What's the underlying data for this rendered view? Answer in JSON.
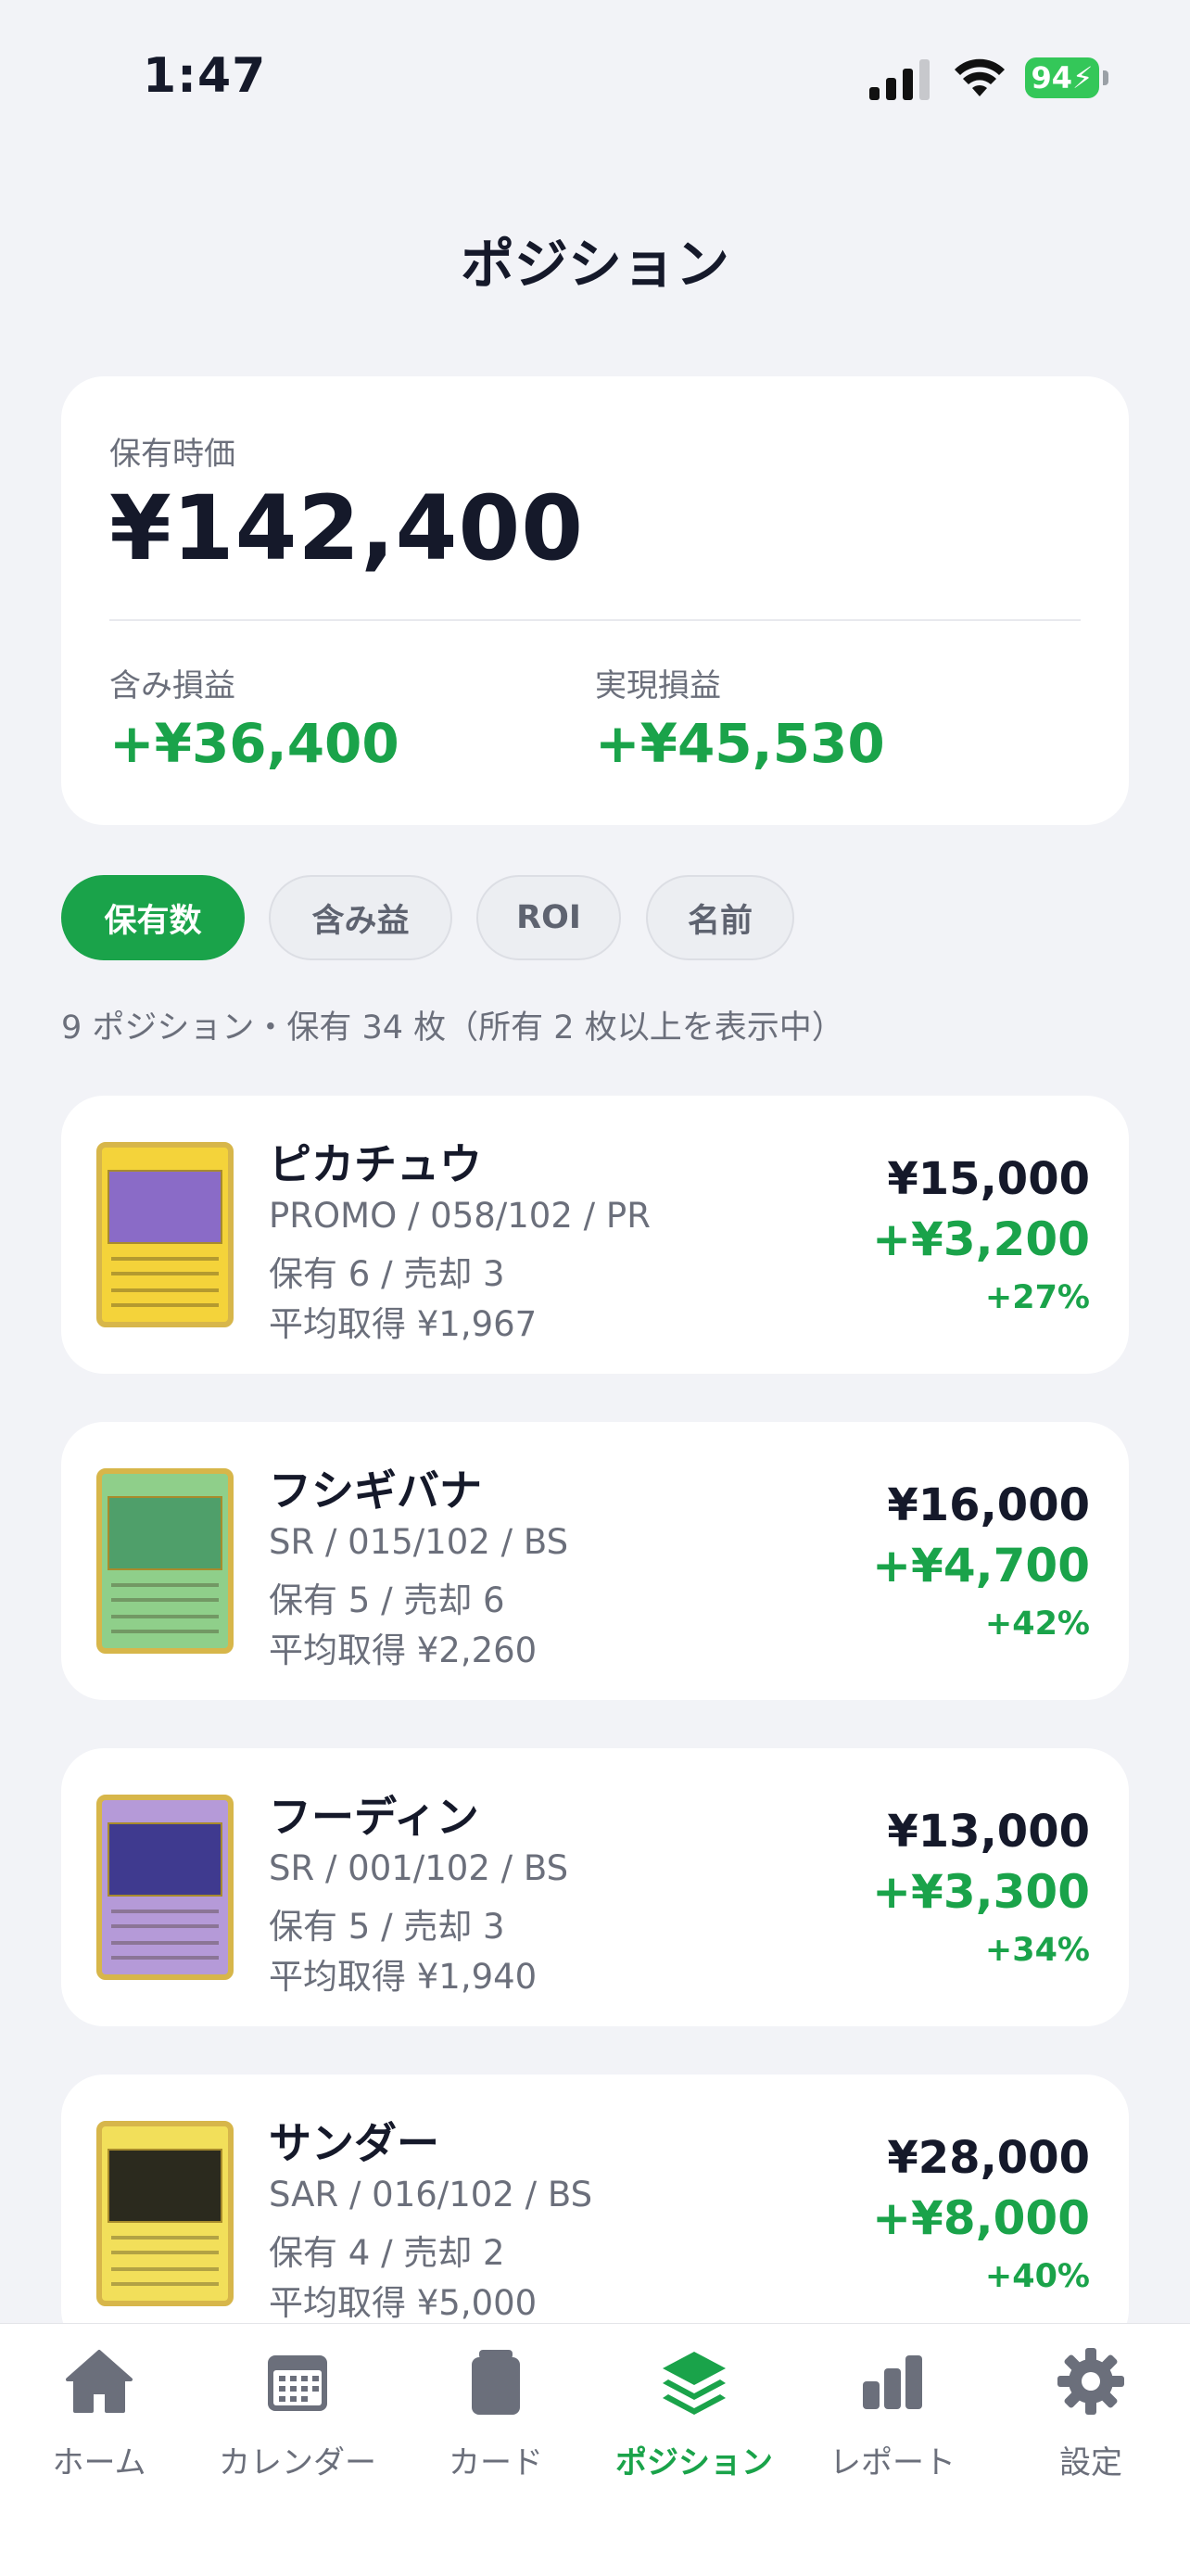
{
  "status_bar": {
    "time": "1:47",
    "battery": "94"
  },
  "title": "ポジション",
  "summary": {
    "holding_value_label": "保有時価",
    "holding_value": "¥142,400",
    "unrealized_label": "含み損益",
    "unrealized_value": "+¥36,400",
    "realized_label": "実現損益",
    "realized_value": "+¥45,530"
  },
  "sort_chips": [
    "保有数",
    "含み益",
    "ROI",
    "名前"
  ],
  "active_chip": "保有数",
  "caption": "9 ポジション・保有 34 枚（所有 2 枚以上を表示中）",
  "positions": [
    {
      "name": "ピカチュウ",
      "set": "PROMO / 058/102 / PR",
      "holding": "保有 6 / 売却 3",
      "avg": "平均取得 ¥1,967",
      "price": "¥15,000",
      "pl": "+¥3,200",
      "pct": "+27%",
      "card_color": "#f4d33a",
      "art_color": "#8a6bc7"
    },
    {
      "name": "フシギバナ",
      "set": "SR / 015/102 / BS",
      "holding": "保有 5 / 売却 6",
      "avg": "平均取得 ¥2,260",
      "price": "¥16,000",
      "pl": "+¥4,700",
      "pct": "+42%",
      "card_color": "#8fcf8a",
      "art_color": "#4f9f6a"
    },
    {
      "name": "フーディン",
      "set": "SR / 001/102 / BS",
      "holding": "保有 5 / 売却 3",
      "avg": "平均取得 ¥1,940",
      "price": "¥13,000",
      "pl": "+¥3,300",
      "pct": "+34%",
      "card_color": "#b59ad8",
      "art_color": "#3f3a8f"
    },
    {
      "name": "サンダー",
      "set": "SAR / 016/102 / BS",
      "holding": "保有 4 / 売却 2",
      "avg": "平均取得 ¥5,000",
      "price": "¥28,000",
      "pl": "+¥8,000",
      "pct": "+40%",
      "card_color": "#f2df5a",
      "art_color": "#2b2a1e"
    }
  ],
  "tabs": [
    {
      "label": "ホーム",
      "icon": "home-icon"
    },
    {
      "label": "カレンダー",
      "icon": "calendar-icon"
    },
    {
      "label": "カード",
      "icon": "cards-icon"
    },
    {
      "label": "ポジション",
      "icon": "layers-icon"
    },
    {
      "label": "レポート",
      "icon": "bar-chart-icon"
    },
    {
      "label": "設定",
      "icon": "gear-icon"
    }
  ],
  "active_tab": "ポジション",
  "colors": {
    "accent": "#1aa34a",
    "background": "#f2f3f7",
    "text": "#15192a",
    "muted": "#6b6f7b"
  }
}
